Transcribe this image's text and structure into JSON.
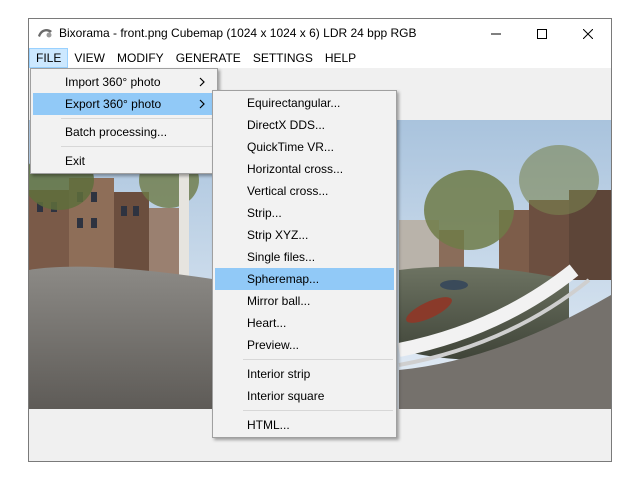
{
  "window": {
    "title": "Bixorama - front.png Cubemap (1024 x 1024 x 6) LDR 24 bpp RGB"
  },
  "menubar": {
    "items": [
      "FILE",
      "VIEW",
      "MODIFY",
      "GENERATE",
      "SETTINGS",
      "HELP"
    ],
    "active": "FILE"
  },
  "file_menu": {
    "import": "Import 360° photo",
    "export": "Export 360° photo",
    "batch": "Batch processing...",
    "exit": "Exit"
  },
  "export_menu": {
    "items": [
      "Equirectangular...",
      "DirectX DDS...",
      "QuickTime VR...",
      "Horizontal cross...",
      "Vertical cross...",
      "Strip...",
      "Strip XYZ...",
      "Single files...",
      "Spheremap...",
      "Mirror ball...",
      "Heart...",
      "Preview...",
      "Interior strip",
      "Interior square",
      "HTML..."
    ],
    "highlighted": "Spheremap..."
  },
  "colors": {
    "menu_highlight": "#91c9f7",
    "menubar_active": "#cce8ff"
  },
  "icons": [
    "app-icon",
    "minimize-icon",
    "maximize-icon",
    "close-icon",
    "submenu-arrow-icon"
  ]
}
